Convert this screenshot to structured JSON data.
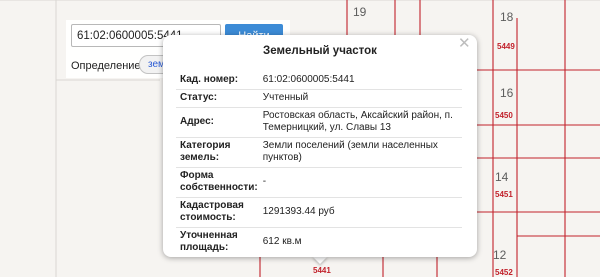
{
  "search": {
    "query": "61:02:0600005:5441",
    "button_label": "Найти",
    "type_label": "Определение:",
    "type_value": "земельный участок"
  },
  "map": {
    "parcel_numbers": [
      "19",
      "18",
      "16",
      "14",
      "12"
    ],
    "parcel_ids": [
      "5449",
      "5450",
      "5451",
      "5441",
      "5452"
    ],
    "line_color": "#c2222c"
  },
  "popup": {
    "title": "Земельный участок",
    "close_icon": "close-icon",
    "rows": [
      {
        "label": "Кад. номер:",
        "value": "61:02:0600005:5441"
      },
      {
        "label": "Статус:",
        "value": "Учтенный"
      },
      {
        "label": "Адрес:",
        "value": "Ростовская область, Аксайский район, п. Темерницкий, ул. Славы 13"
      },
      {
        "label": "Категория земель:",
        "value": "Земли поселений (земли населенных пунктов)"
      },
      {
        "label": "Форма собственности:",
        "value": "-"
      },
      {
        "label": "Кадастровая стоимость:",
        "value": "1291393.44 руб"
      },
      {
        "label": "Уточненная площадь:",
        "value": "612 кв.м"
      }
    ]
  }
}
